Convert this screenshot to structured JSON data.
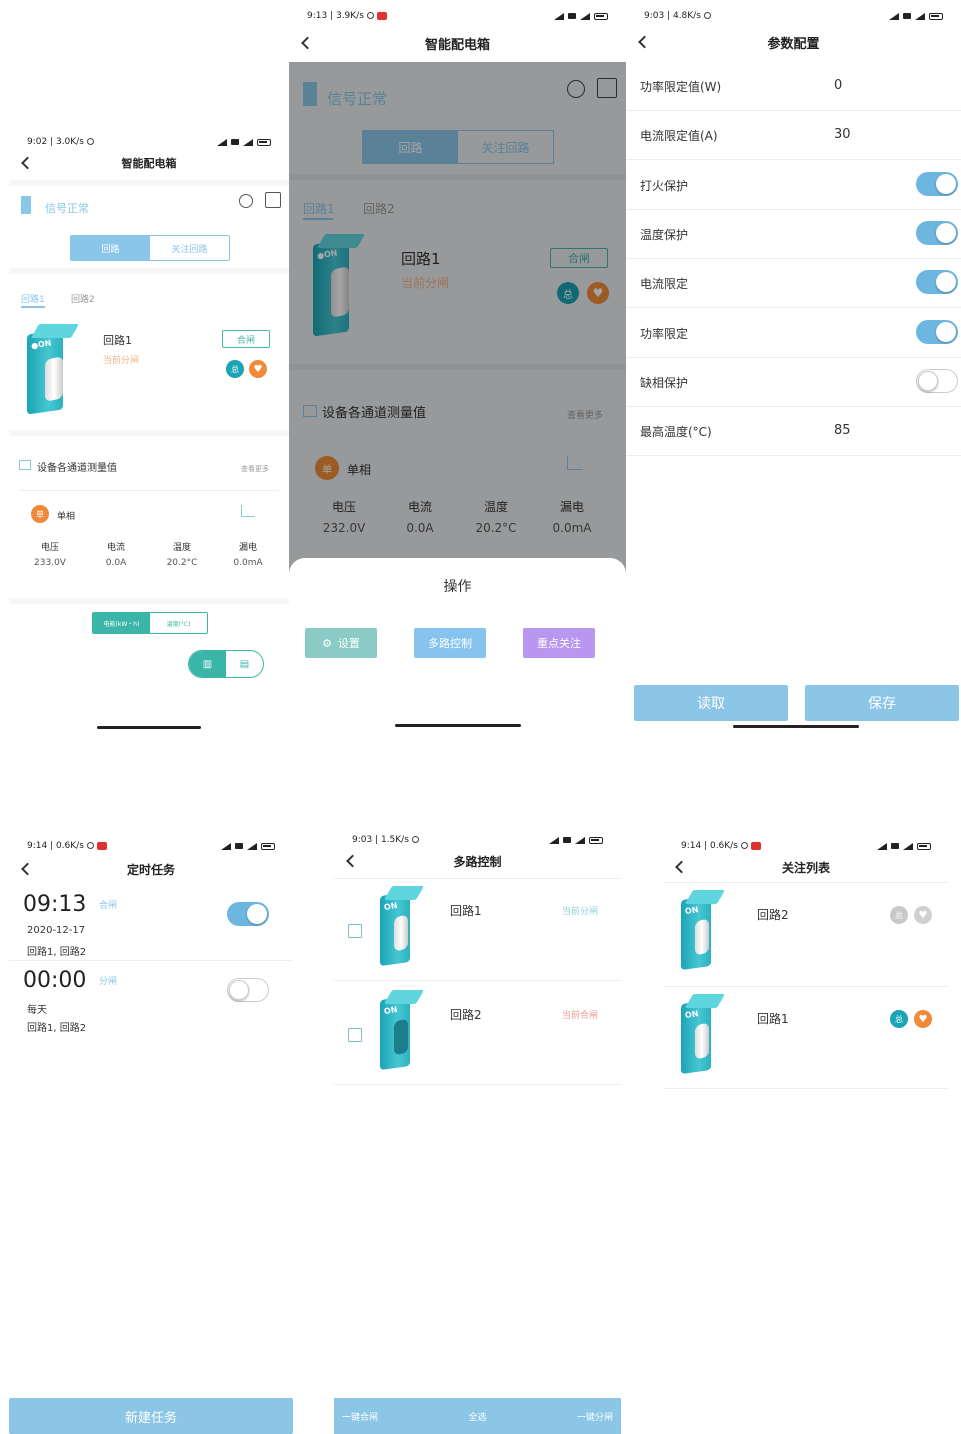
{
  "p1": {
    "status_time": "9:02 | 3.0K/s",
    "title": "智能配电箱",
    "signal": "信号正常",
    "seg": [
      "回路",
      "关注回路"
    ],
    "tabs": [
      "回路1",
      "回路2"
    ],
    "circuit_name": "回路1",
    "circuit_state": "当前分闸",
    "btn_close": "合闸",
    "badge": "总",
    "measure_title": "设备各通道测量值",
    "more": "查看更多",
    "phase": "单相",
    "phase_icon": "单",
    "cols": [
      "电压",
      "电流",
      "温度",
      "漏电"
    ],
    "vals": [
      "233.0V",
      "0.0A",
      "20.2°C",
      "0.0mA"
    ],
    "seg2": [
      "电能(kW・h)",
      "温度(°C)"
    ]
  },
  "p2": {
    "status_time": "9:13 | 3.9K/s",
    "title": "智能配电箱",
    "signal": "信号正常",
    "seg": [
      "回路",
      "关注回路"
    ],
    "tabs": [
      "回路1",
      "回路2"
    ],
    "circuit_name": "回路1",
    "circuit_state": "当前分闸",
    "btn_close": "合闸",
    "badge": "总",
    "measure_title": "设备各通道测量值",
    "more": "查看更多",
    "phase": "单相",
    "phase_icon": "单",
    "cols": [
      "电压",
      "电流",
      "温度",
      "漏电"
    ],
    "vals": [
      "232.0V",
      "0.0A",
      "20.2°C",
      "0.0mA"
    ],
    "sheet_title": "操作",
    "sheet_btns": [
      "设置",
      "多路控制",
      "重点关注"
    ]
  },
  "p3": {
    "status_time": "9:03 | 4.8K/s",
    "title": "参数配置",
    "rows": [
      {
        "label": "功率限定值(W)",
        "value": "0"
      },
      {
        "label": "电流限定值(A)",
        "value": "30"
      },
      {
        "label": "打火保护",
        "on": true
      },
      {
        "label": "温度保护",
        "on": true
      },
      {
        "label": "电流限定",
        "on": true
      },
      {
        "label": "功率限定",
        "on": true
      },
      {
        "label": "缺相保护",
        "on": false
      },
      {
        "label": "最高温度(°C)",
        "value": "85"
      }
    ],
    "read": "读取",
    "save": "保存"
  },
  "p4": {
    "status_time": "9:14 | 0.6K/s",
    "title": "定时任务",
    "tasks": [
      {
        "time": "09:13",
        "action": "合闸",
        "date": "2020-12-17",
        "circuits": "回路1, 回路2",
        "on": true
      },
      {
        "time": "00:00",
        "action": "分闸",
        "date": "每天",
        "circuits": "回路1, 回路2",
        "on": false
      }
    ],
    "new_task": "新建任务"
  },
  "p5": {
    "status_time": "9:03 | 1.5K/s",
    "title": "多路控制",
    "items": [
      {
        "name": "回路1",
        "state": "当前分闸"
      },
      {
        "name": "回路2",
        "state": "当前合闸"
      }
    ],
    "bottom": [
      "一键合闸",
      "全选",
      "一键分闸"
    ]
  },
  "p6": {
    "status_time": "9:14 | 0.6K/s",
    "title": "关注列表",
    "items": [
      {
        "name": "回路2",
        "badge": "总"
      },
      {
        "name": "回路1",
        "badge": "总"
      }
    ]
  },
  "colors": {
    "teal": "#1aa4b5",
    "blue": "#6cb6e0",
    "orange": "#f08a3a",
    "red": "#e0464b",
    "purple": "#b38cf0"
  }
}
